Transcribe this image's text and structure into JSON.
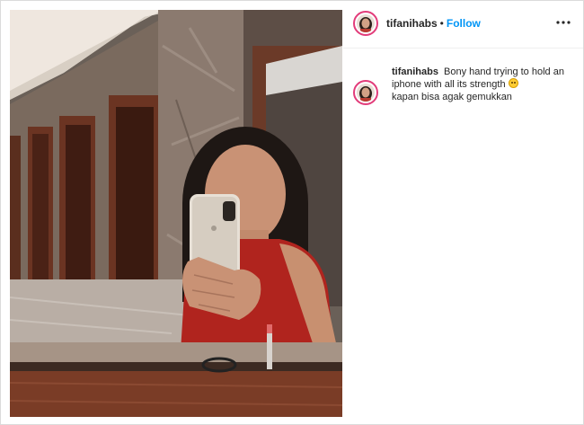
{
  "post": {
    "username": "tifanihabs",
    "separator": "•",
    "follow_label": "Follow",
    "more_icon": "more-options-icon",
    "photo_description_icon": "post-photo"
  },
  "caption": {
    "username": "tifanihabs",
    "text": "Bony hand trying to hold an iphone with all its strength",
    "emoji": "face-rolling-eyes-emoji",
    "text2": "kapan bisa agak gemukkan"
  },
  "colors": {
    "follow": "#0095f6",
    "avatar_ring": "#e23c7a",
    "text": "#262626"
  }
}
